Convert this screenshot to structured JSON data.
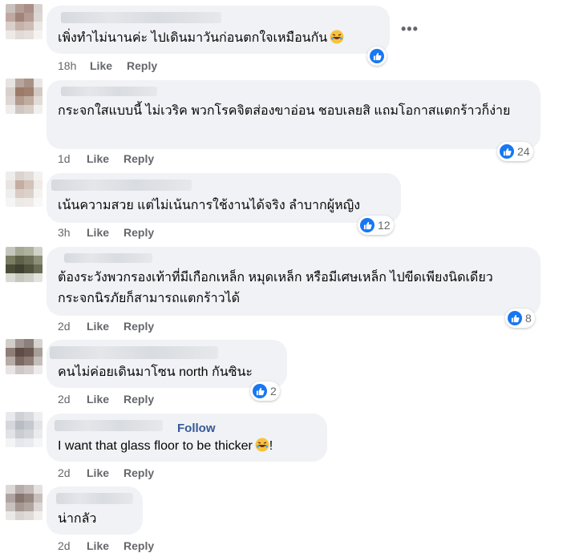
{
  "comments": [
    {
      "text": "เพิ่งทำไม่นานค่ะ ไปเดินมาวันก่อนตกใจเหมือนกัน",
      "time": "18h",
      "like": "Like",
      "reply": "Reply",
      "reactions": ""
    },
    {
      "text": "กระจกใสแบบนี้ ไม่เวริค พวกโรคจิตส่องขาอ่อน ชอบเลยสิ แถมโอกาสแตกร้าวก็ง่าย",
      "time": "1d",
      "like": "Like",
      "reply": "Reply",
      "reactions": "24"
    },
    {
      "text": "เน้นความสวย แต่ไม่เน้นการใช้งานได้จริง ลำบากผู้หญิง",
      "time": "3h",
      "like": "Like",
      "reply": "Reply",
      "reactions": "12"
    },
    {
      "text": "ต้องระวังพวกรองเท้าที่มีเกือกเหล็ก หมุดเหล็ก หรือมีเศษเหล็ก ไปขีดเพียงนิดเดียว กระจกนิรภัยก็สามารถแตกร้าวได้",
      "time": "2d",
      "like": "Like",
      "reply": "Reply",
      "reactions": "8"
    },
    {
      "text": "คนไม่ค่อยเดินมาโซน north กันซินะ",
      "time": "2d",
      "like": "Like",
      "reply": "Reply",
      "reactions": "2"
    },
    {
      "text": "I want that glass floor to be thicker",
      "text_after": "!",
      "follow": "Follow",
      "time": "2d",
      "like": "Like",
      "reply": "Reply",
      "reactions": ""
    },
    {
      "text": "น่ากลัว",
      "time": "2d",
      "like": "Like",
      "reply": "Reply",
      "reactions": ""
    }
  ],
  "more_options": "•••",
  "colors": {
    "like_blue": "#1877f2",
    "bubble": "#f0f2f5",
    "meta": "#65676b"
  }
}
